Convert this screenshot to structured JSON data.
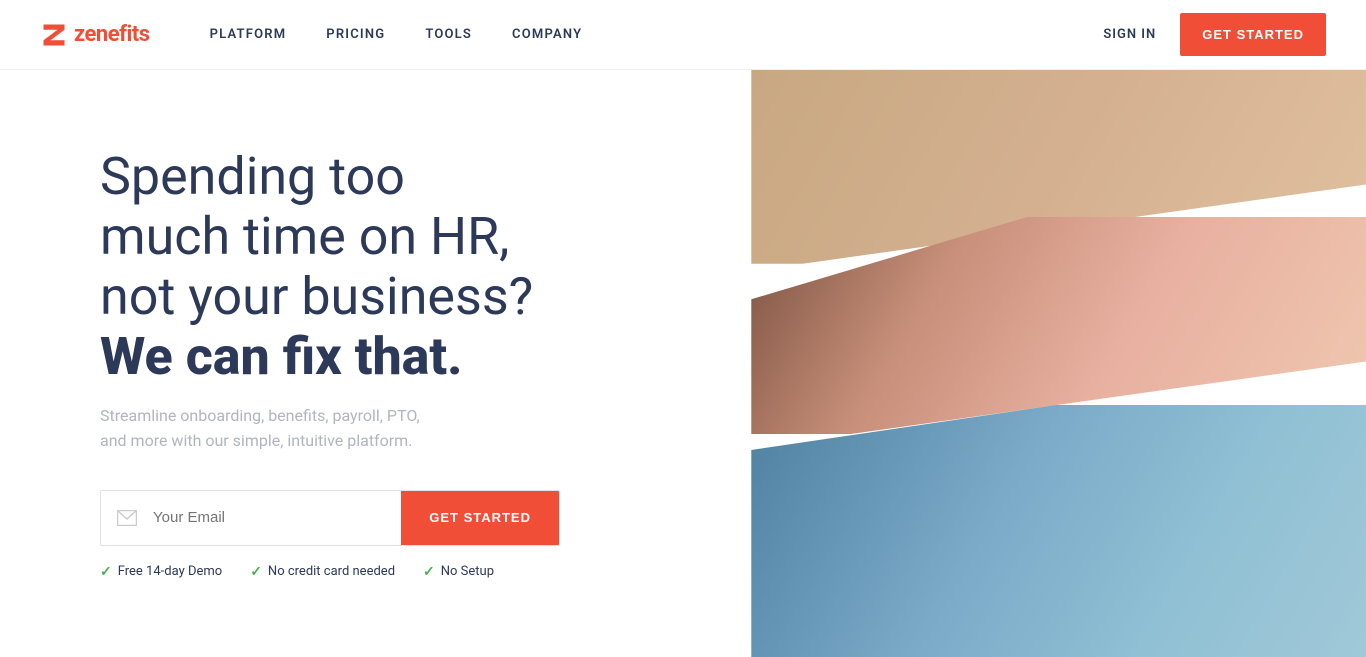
{
  "brand": {
    "name": "zenefits",
    "logo_icon": "Z"
  },
  "nav": {
    "links": [
      {
        "id": "platform",
        "label": "PLATFORM"
      },
      {
        "id": "pricing",
        "label": "PRICING"
      },
      {
        "id": "tools",
        "label": "TOOLS"
      },
      {
        "id": "company",
        "label": "COMPANY"
      }
    ],
    "sign_in_label": "SIGN IN",
    "cta_label": "GET STARTED"
  },
  "hero": {
    "heading_line1": "Spending too",
    "heading_line2": "much time on HR,",
    "heading_line3": "not your business?",
    "heading_bold": "We can fix that.",
    "subtext": "Streamline onboarding, benefits, payroll, PTO,\nand more with our simple, intuitive platform.",
    "email_placeholder": "Your Email",
    "cta_label": "GET STARTED",
    "trust_items": [
      {
        "id": "demo",
        "label": "Free 14-day Demo"
      },
      {
        "id": "card",
        "label": "No credit card needed"
      },
      {
        "id": "setup",
        "label": "No Setup"
      }
    ]
  },
  "colors": {
    "brand_red": "#f04e37",
    "dark_blue": "#2d3958",
    "light_gray": "#b0b5c0",
    "green_check": "#4caf50"
  }
}
